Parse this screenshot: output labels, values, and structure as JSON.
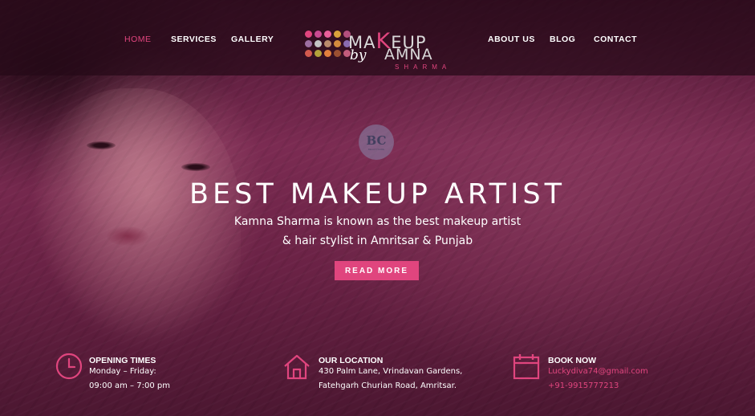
{
  "nav": {
    "items": [
      {
        "label": "HOME",
        "active": true
      },
      {
        "label": "SERVICES",
        "active": false
      },
      {
        "label": "GALLERY",
        "active": false
      },
      {
        "label": "ABOUT US",
        "active": false
      },
      {
        "label": "BLOG",
        "active": false
      },
      {
        "label": "CONTACT",
        "active": false
      }
    ]
  },
  "logo": {
    "line1_a": "MA",
    "line1_k": "K",
    "line1_b": "EUP",
    "by": "by",
    "line2": "AMNA",
    "line3": "SHARMA",
    "dot_colors": [
      "#e0457e",
      "#c94a91",
      "#e85e9a",
      "#d9a13a",
      "#b44f7d",
      "#9c6fa1",
      "#c4c4c4",
      "#b98a6c",
      "#d38a3d",
      "#8a6bb0",
      "#d25a4e",
      "#b3a23a",
      "#e27f3d",
      "#9a4f31",
      "#c25b7c"
    ]
  },
  "watermark": {
    "initials": "BC",
    "sub": "BEAUTYCARE"
  },
  "hero": {
    "headline": "BEST MAKEUP ARTIST",
    "subline1": "Kamna Sharma is known as the best makeup artist",
    "subline2": "& hair stylist in Amritsar & Punjab",
    "cta_label": "READ MORE"
  },
  "info": {
    "hours": {
      "icon": "clock-icon",
      "title": "OPENING TIMES",
      "line1": "Monday – Friday:",
      "line2": "09:00 am – 7:00 pm"
    },
    "location": {
      "icon": "house-icon",
      "title": "OUR LOCATION",
      "line1": "430 Palm Lane, Vrindavan Gardens,",
      "line2": "Fatehgarh Churian Road, Amritsar."
    },
    "booking": {
      "icon": "calendar-icon",
      "title": "BOOK NOW",
      "email": "Luckydiva74@gmail.com",
      "phone": "+91-9915777213"
    }
  },
  "colors": {
    "accent": "#e0457e",
    "overlay": "#5a1f3a"
  }
}
